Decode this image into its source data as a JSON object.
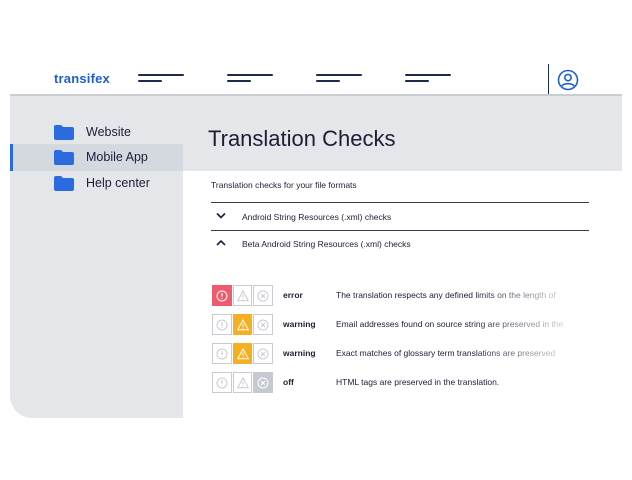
{
  "app": {
    "logo": "transifex",
    "brand_color": "#1f5fd1",
    "nav_placeholders": [
      "nav-1",
      "nav-2",
      "nav-3",
      "nav-4"
    ],
    "avatar_icon": "user-circle-icon"
  },
  "sidebar": {
    "items": [
      {
        "label": "Website",
        "icon": "folder-icon",
        "active": false
      },
      {
        "label": "Mobile App",
        "icon": "folder-icon",
        "active": true
      },
      {
        "label": "Help center",
        "icon": "folder-icon",
        "active": false
      }
    ]
  },
  "main": {
    "title": "Translation Checks",
    "subtitle": "Translation checks for your file formats",
    "sections": [
      {
        "label": "Android String Resources (.xml) checks",
        "expanded": false
      },
      {
        "label": "Beta Android String Resources  (.xml) checks",
        "expanded": true
      }
    ],
    "checks": [
      {
        "severity": "error",
        "description": "The translation respects any defined limits on the length of"
      },
      {
        "severity": "warning",
        "description": "Email addresses found on source string are preserved in the"
      },
      {
        "severity": "warning",
        "description": "Exact matches of glossary term translations are preserved"
      },
      {
        "severity": "off",
        "description": "HTML tags are preserved in the translation."
      }
    ]
  },
  "colors": {
    "error": "#ef5b6e",
    "warning": "#f5b021",
    "off": "#c5c9d0",
    "sidebar_bg": "#e4e6ea"
  }
}
